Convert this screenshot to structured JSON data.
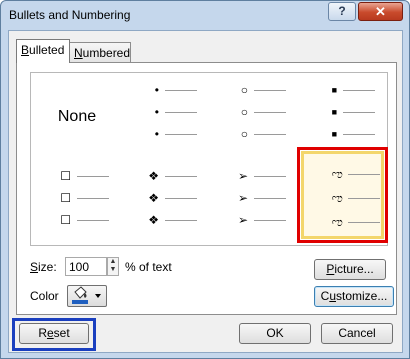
{
  "window": {
    "title": "Bullets and Numbering",
    "help_glyph": "?",
    "close_glyph": "✕"
  },
  "tabs": [
    {
      "label": "Bulleted",
      "hotkey": "B",
      "rest": "ulleted"
    },
    {
      "label": "Numbered",
      "hotkey": "N",
      "rest": "umbered"
    }
  ],
  "bullets": {
    "none_label": "None",
    "rows": [
      [
        {
          "type": "none",
          "symbol": ""
        },
        {
          "type": "dot",
          "symbol": "•"
        },
        {
          "type": "circle",
          "symbol": "○"
        },
        {
          "type": "square-small",
          "symbol": "■"
        }
      ],
      [
        {
          "type": "hollow-square",
          "symbol": "☐"
        },
        {
          "type": "diamond-dots",
          "symbol": "❖"
        },
        {
          "type": "arrowhead",
          "symbol": "➢"
        },
        {
          "type": "scroll",
          "symbol": "ಌ"
        }
      ]
    ],
    "selected": "scroll"
  },
  "size": {
    "label": "Size:",
    "hotkey": "S",
    "rest": "ize:",
    "value": "100",
    "unit_label": "% of text"
  },
  "color": {
    "label": "Color",
    "swatch": "#1f5fbf"
  },
  "buttons": {
    "picture": {
      "label": "Picture...",
      "hotkey": "P",
      "rest": "icture..."
    },
    "customize": {
      "label": "Customize...",
      "hotkey": "u",
      "pre": "C",
      "rest": "stomize..."
    },
    "reset": {
      "label": "Reset",
      "pre": "R",
      "hotkey": "e",
      "rest": "set"
    },
    "ok": {
      "label": "OK"
    },
    "cancel": {
      "label": "Cancel"
    }
  },
  "accents": {
    "selection_border": "#e00000",
    "selection_fill": "#f3d66b",
    "reset_highlight": "#1a3fbf"
  }
}
